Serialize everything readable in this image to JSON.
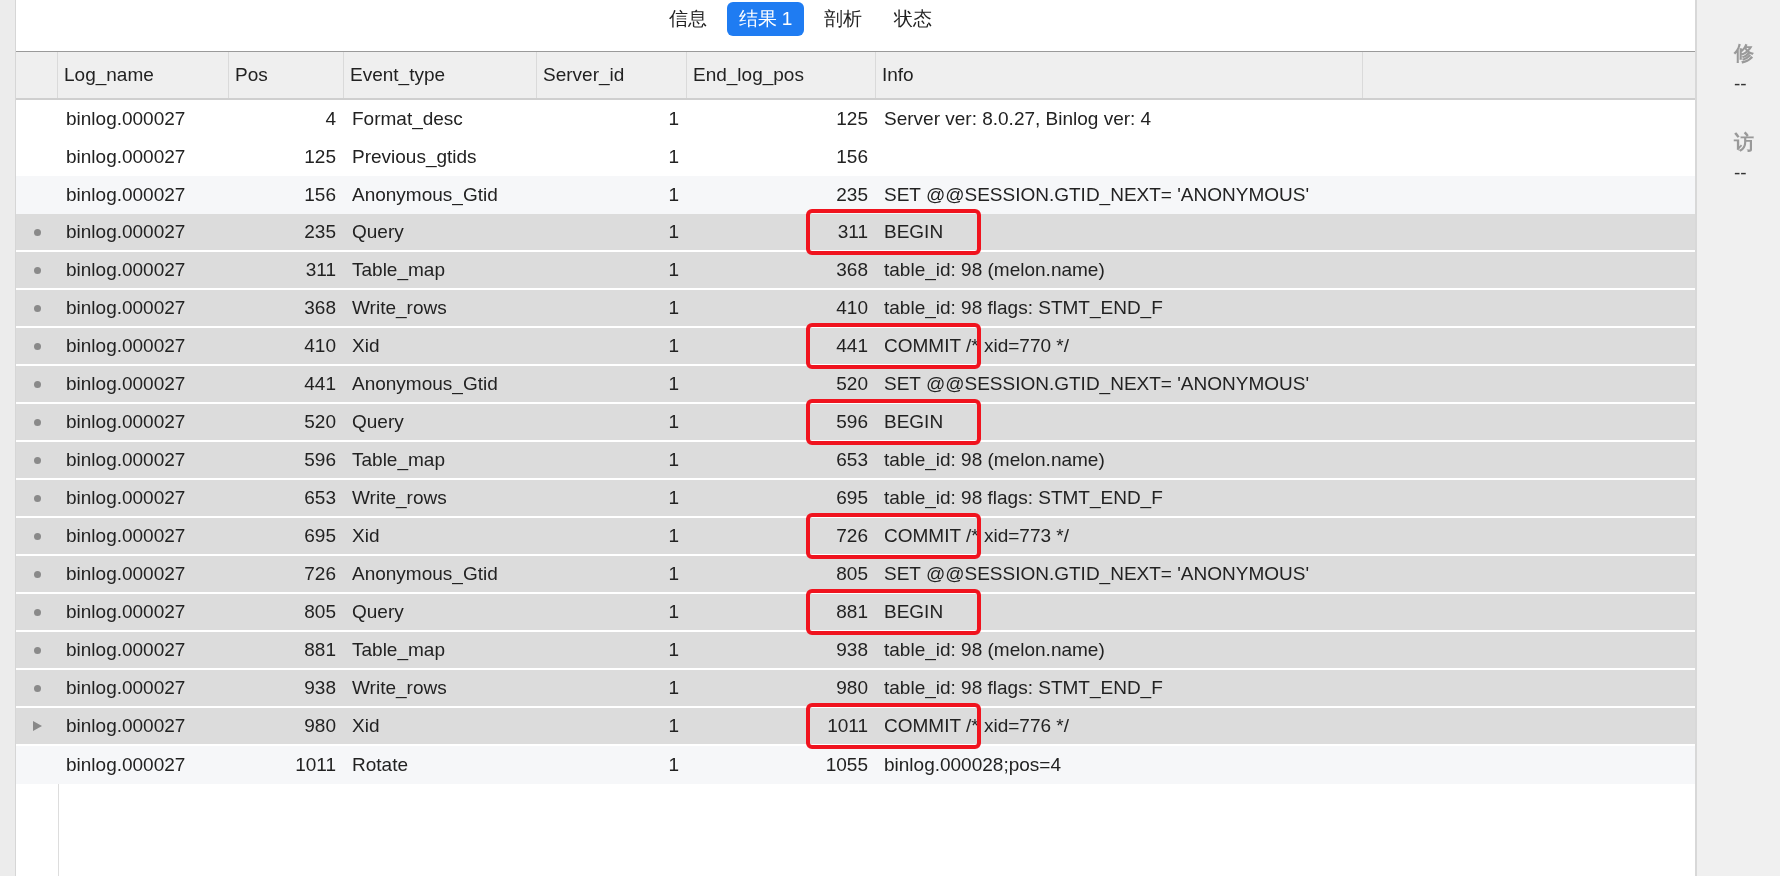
{
  "tabs": [
    {
      "label": "信息",
      "selected": false
    },
    {
      "label": "结果 1",
      "selected": true
    },
    {
      "label": "剖析",
      "selected": false
    },
    {
      "label": "状态",
      "selected": false
    }
  ],
  "table": {
    "columns": [
      "Log_name",
      "Pos",
      "Event_type",
      "Server_id",
      "End_log_pos",
      "Info"
    ],
    "rows": [
      {
        "kind": "plain",
        "selected": false,
        "highlighted": false,
        "cells": [
          "binlog.000027",
          "4",
          "Format_desc",
          "1",
          "125",
          "Server ver: 8.0.27, Binlog ver: 4"
        ]
      },
      {
        "kind": "plain",
        "selected": false,
        "highlighted": false,
        "cells": [
          "binlog.000027",
          "125",
          "Previous_gtids",
          "1",
          "156",
          ""
        ]
      },
      {
        "kind": "plain",
        "selected": false,
        "highlighted": false,
        "cells": [
          "binlog.000027",
          "156",
          "Anonymous_Gtid",
          "1",
          "235",
          "SET @@SESSION.GTID_NEXT= 'ANONYMOUS'"
        ]
      },
      {
        "kind": "dot",
        "selected": true,
        "highlighted": true,
        "cells": [
          "binlog.000027",
          "235",
          "Query",
          "1",
          "311",
          "BEGIN"
        ]
      },
      {
        "kind": "dot",
        "selected": true,
        "highlighted": false,
        "cells": [
          "binlog.000027",
          "311",
          "Table_map",
          "1",
          "368",
          "table_id: 98 (melon.name)"
        ]
      },
      {
        "kind": "dot",
        "selected": true,
        "highlighted": false,
        "cells": [
          "binlog.000027",
          "368",
          "Write_rows",
          "1",
          "410",
          "table_id: 98 flags: STMT_END_F"
        ]
      },
      {
        "kind": "dot",
        "selected": true,
        "highlighted": true,
        "cells": [
          "binlog.000027",
          "410",
          "Xid",
          "1",
          "441",
          "COMMIT /* xid=770 */"
        ]
      },
      {
        "kind": "dot",
        "selected": true,
        "highlighted": false,
        "cells": [
          "binlog.000027",
          "441",
          "Anonymous_Gtid",
          "1",
          "520",
          "SET @@SESSION.GTID_NEXT= 'ANONYMOUS'"
        ]
      },
      {
        "kind": "dot",
        "selected": true,
        "highlighted": true,
        "cells": [
          "binlog.000027",
          "520",
          "Query",
          "1",
          "596",
          "BEGIN"
        ]
      },
      {
        "kind": "dot",
        "selected": true,
        "highlighted": false,
        "cells": [
          "binlog.000027",
          "596",
          "Table_map",
          "1",
          "653",
          "table_id: 98 (melon.name)"
        ]
      },
      {
        "kind": "dot",
        "selected": true,
        "highlighted": false,
        "cells": [
          "binlog.000027",
          "653",
          "Write_rows",
          "1",
          "695",
          "table_id: 98 flags: STMT_END_F"
        ]
      },
      {
        "kind": "dot",
        "selected": true,
        "highlighted": true,
        "cells": [
          "binlog.000027",
          "695",
          "Xid",
          "1",
          "726",
          "COMMIT /* xid=773 */"
        ]
      },
      {
        "kind": "dot",
        "selected": true,
        "highlighted": false,
        "cells": [
          "binlog.000027",
          "726",
          "Anonymous_Gtid",
          "1",
          "805",
          "SET @@SESSION.GTID_NEXT= 'ANONYMOUS'"
        ]
      },
      {
        "kind": "dot",
        "selected": true,
        "highlighted": true,
        "cells": [
          "binlog.000027",
          "805",
          "Query",
          "1",
          "881",
          "BEGIN"
        ]
      },
      {
        "kind": "dot",
        "selected": true,
        "highlighted": false,
        "cells": [
          "binlog.000027",
          "881",
          "Table_map",
          "1",
          "938",
          "table_id: 98 (melon.name)"
        ]
      },
      {
        "kind": "dot",
        "selected": true,
        "highlighted": false,
        "cells": [
          "binlog.000027",
          "938",
          "Write_rows",
          "1",
          "980",
          "table_id: 98 flags: STMT_END_F"
        ]
      },
      {
        "kind": "arrow",
        "selected": true,
        "highlighted": true,
        "cells": [
          "binlog.000027",
          "980",
          "Xid",
          "1",
          "1011",
          "COMMIT /* xid=776 */"
        ]
      },
      {
        "kind": "plain",
        "selected": false,
        "highlighted": false,
        "cells": [
          "binlog.000027",
          "1011",
          "Rotate",
          "1",
          "1055",
          "binlog.000028;pos=4"
        ]
      }
    ]
  },
  "sidebar": {
    "fields": [
      {
        "label": "修",
        "value": "--"
      },
      {
        "label": "访",
        "value": "--"
      }
    ]
  }
}
